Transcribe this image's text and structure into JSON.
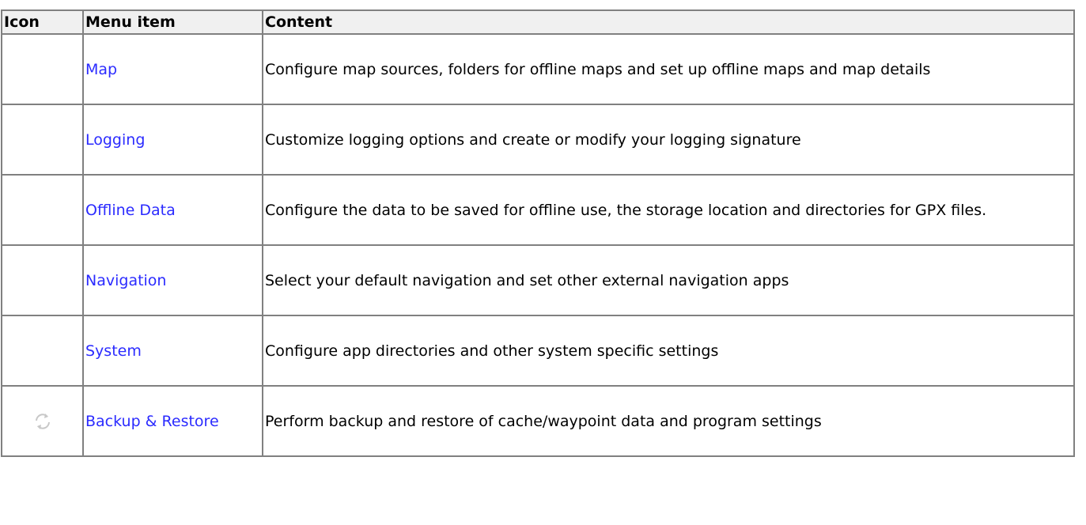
{
  "table": {
    "headers": {
      "icon": "Icon",
      "menu_item": "Menu item",
      "content": "Content"
    },
    "rows": [
      {
        "icon": "",
        "menu_item": "Map",
        "content": "Configure map sources, folders for offline maps and set up offline maps and map details"
      },
      {
        "icon": "",
        "menu_item": "Logging",
        "content": "Customize logging options and create or modify your logging signature"
      },
      {
        "icon": "",
        "menu_item": "Offline Data",
        "content": "Configure the data to be saved for offline use, the storage location and directories for GPX files."
      },
      {
        "icon": "",
        "menu_item": "Navigation",
        "content": "Select your default navigation and set other external navigation apps"
      },
      {
        "icon": "",
        "menu_item": "System",
        "content": "Configure app directories and other system specific settings"
      },
      {
        "icon": "sync-arrows-icon",
        "menu_item": "Backup & Restore",
        "content": "Perform backup and restore of cache/waypoint data and program settings"
      }
    ]
  },
  "colors": {
    "link": "#2b2bff",
    "border": "#808080",
    "header_bg": "#f0f0f0"
  }
}
